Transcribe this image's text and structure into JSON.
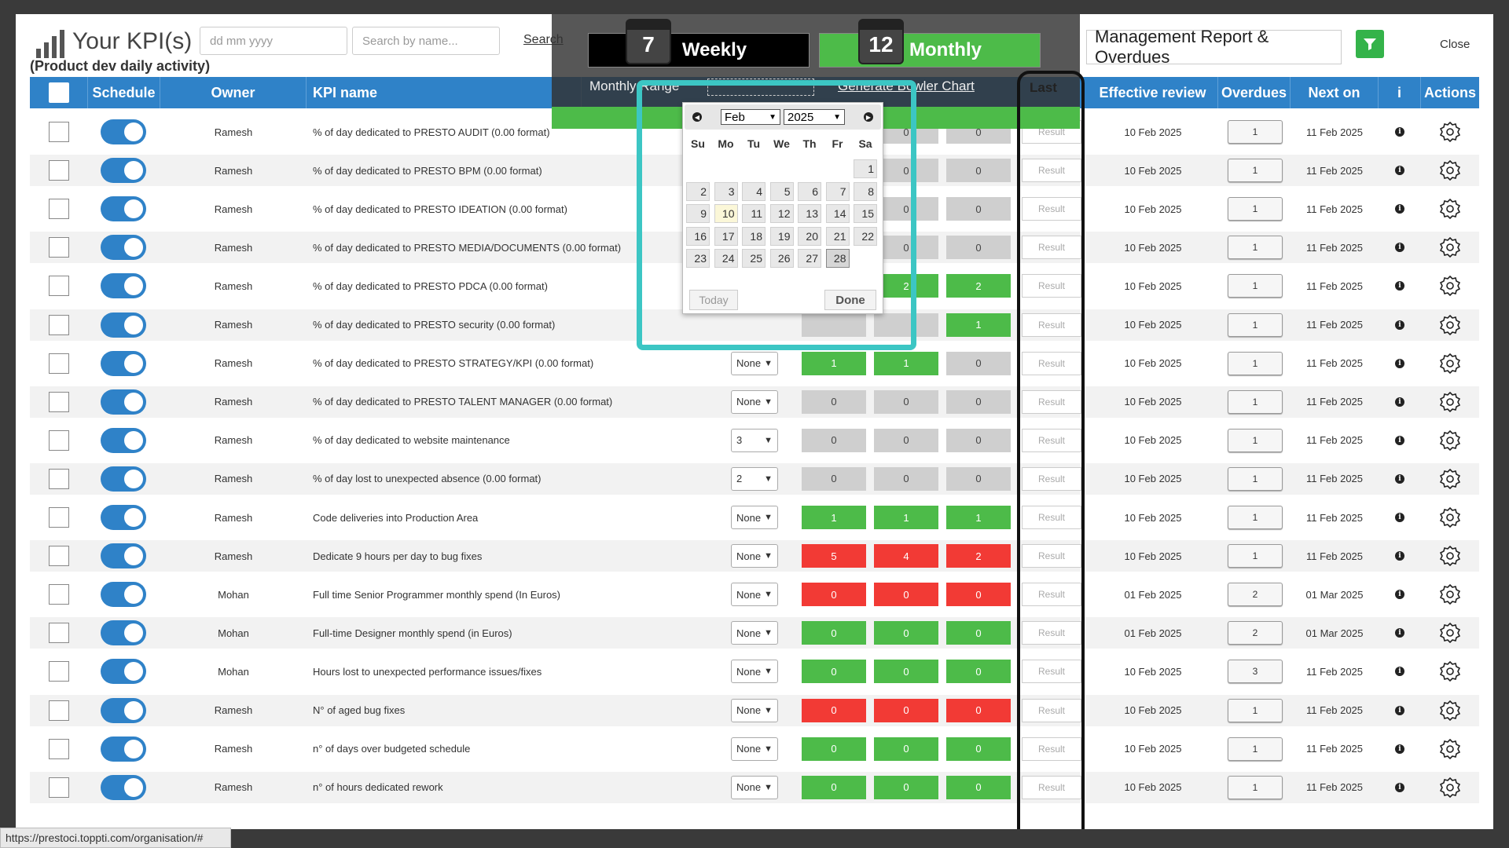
{
  "header": {
    "title": "Your KPI(s)",
    "subtitle": "(Product dev daily activity)",
    "date_placeholder": "dd mm yyyy",
    "search_placeholder": "Search by name...",
    "search_link": "Search",
    "report_title": "Management Report & Overdues",
    "close_label": "Close",
    "filter_icon": "filter-icon"
  },
  "period": {
    "weekly_label": "Weekly",
    "weekly_icon_num": "7",
    "monthly_label": "Monthly",
    "monthly_icon_num": "12",
    "monthly_range_label": "Monthly Range",
    "generate_label": "Generate Bowler Chart",
    "last_label": "Last",
    "accent_color": "#4dbb49"
  },
  "datepicker": {
    "month": "Feb",
    "year": "2025",
    "weekdays": [
      "Su",
      "Mo",
      "Tu",
      "We",
      "Th",
      "Fr",
      "Sa"
    ],
    "weeks": [
      [
        "",
        "",
        "",
        "",
        "",
        "",
        "1"
      ],
      [
        "2",
        "3",
        "4",
        "5",
        "6",
        "7",
        "8"
      ],
      [
        "9",
        "10",
        "11",
        "12",
        "13",
        "14",
        "15"
      ],
      [
        "16",
        "17",
        "18",
        "19",
        "20",
        "21",
        "22"
      ],
      [
        "23",
        "24",
        "25",
        "26",
        "27",
        "28",
        ""
      ]
    ],
    "today": "10",
    "selected": "28",
    "today_btn": "Today",
    "done_btn": "Done"
  },
  "table": {
    "columns": [
      "Schedule",
      "Owner",
      "KPI name",
      "Effective review",
      "Overdues",
      "Next on",
      "i",
      "Actions"
    ],
    "result_placeholder": "Result",
    "rows": [
      {
        "owner": "Ramesh",
        "kpi": "% of day dedicated to PRESTO AUDIT (0.00 format)",
        "select": "",
        "v": [
          "",
          "0",
          "0"
        ],
        "c": [
          "",
          "grey",
          "grey"
        ],
        "review": "10 Feb 2025",
        "overdue": "1",
        "next": "11 Feb 2025"
      },
      {
        "owner": "Ramesh",
        "kpi": "% of day dedicated to PRESTO BPM (0.00 format)",
        "select": "",
        "v": [
          "",
          "0",
          "0"
        ],
        "c": [
          "",
          "grey",
          "grey"
        ],
        "review": "10 Feb 2025",
        "overdue": "1",
        "next": "11 Feb 2025"
      },
      {
        "owner": "Ramesh",
        "kpi": "% of day dedicated to PRESTO IDEATION (0.00 format)",
        "select": "",
        "v": [
          "",
          "0",
          "0"
        ],
        "c": [
          "",
          "grey",
          "grey"
        ],
        "review": "10 Feb 2025",
        "overdue": "1",
        "next": "11 Feb 2025"
      },
      {
        "owner": "Ramesh",
        "kpi": "% of day dedicated to PRESTO MEDIA/DOCUMENTS (0.00 format)",
        "select": "",
        "v": [
          "",
          "0",
          "0"
        ],
        "c": [
          "",
          "grey",
          "grey"
        ],
        "review": "10 Feb 2025",
        "overdue": "1",
        "next": "11 Feb 2025"
      },
      {
        "owner": "Ramesh",
        "kpi": "% of day dedicated to PRESTO PDCA (0.00 format)",
        "select": "",
        "v": [
          "",
          "2",
          "2"
        ],
        "c": [
          "",
          "green",
          "green"
        ],
        "review": "10 Feb 2025",
        "overdue": "1",
        "next": "11 Feb 2025"
      },
      {
        "owner": "Ramesh",
        "kpi": "% of day dedicated to PRESTO security (0.00 format)",
        "select": "",
        "v": [
          "",
          "",
          "1"
        ],
        "c": [
          "grey",
          "grey",
          "green"
        ],
        "review": "10 Feb 2025",
        "overdue": "1",
        "next": "11 Feb 2025"
      },
      {
        "owner": "Ramesh",
        "kpi": "% of day dedicated to PRESTO STRATEGY/KPI (0.00 format)",
        "select": "None",
        "v": [
          "1",
          "1",
          "0"
        ],
        "c": [
          "green",
          "green",
          "grey"
        ],
        "review": "10 Feb 2025",
        "overdue": "1",
        "next": "11 Feb 2025"
      },
      {
        "owner": "Ramesh",
        "kpi": "% of day dedicated to PRESTO TALENT MANAGER (0.00 format)",
        "select": "None",
        "v": [
          "0",
          "0",
          "0"
        ],
        "c": [
          "grey",
          "grey",
          "grey"
        ],
        "review": "10 Feb 2025",
        "overdue": "1",
        "next": "11 Feb 2025"
      },
      {
        "owner": "Ramesh",
        "kpi": "% of day dedicated to website maintenance",
        "select": "3",
        "v": [
          "0",
          "0",
          "0"
        ],
        "c": [
          "grey",
          "grey",
          "grey"
        ],
        "review": "10 Feb 2025",
        "overdue": "1",
        "next": "11 Feb 2025"
      },
      {
        "owner": "Ramesh",
        "kpi": "% of day lost to unexpected absence (0.00 format)",
        "select": "2",
        "v": [
          "0",
          "0",
          "0"
        ],
        "c": [
          "grey",
          "grey",
          "grey"
        ],
        "review": "10 Feb 2025",
        "overdue": "1",
        "next": "11 Feb 2025"
      },
      {
        "owner": "Ramesh",
        "kpi": "Code deliveries into Production Area",
        "select": "None",
        "v": [
          "1",
          "1",
          "1"
        ],
        "c": [
          "green",
          "green",
          "green"
        ],
        "review": "10 Feb 2025",
        "overdue": "1",
        "next": "11 Feb 2025"
      },
      {
        "owner": "Ramesh",
        "kpi": "Dedicate 9 hours per day to bug fixes",
        "select": "None",
        "v": [
          "5",
          "4",
          "2"
        ],
        "c": [
          "red",
          "red",
          "red"
        ],
        "review": "10 Feb 2025",
        "overdue": "1",
        "next": "11 Feb 2025"
      },
      {
        "owner": "Mohan",
        "kpi": "Full time Senior Programmer monthly spend (In Euros)",
        "select": "None",
        "v": [
          "0",
          "0",
          "0"
        ],
        "c": [
          "red",
          "red",
          "red"
        ],
        "review": "01 Feb 2025",
        "overdue": "2",
        "next": "01 Mar 2025"
      },
      {
        "owner": "Mohan",
        "kpi": "Full-time Designer monthly spend (in Euros)",
        "select": "None",
        "v": [
          "0",
          "0",
          "0"
        ],
        "c": [
          "green",
          "green",
          "green"
        ],
        "review": "01 Feb 2025",
        "overdue": "2",
        "next": "01 Mar 2025"
      },
      {
        "owner": "Mohan",
        "kpi": "Hours lost to unexpected performance issues/fixes",
        "select": "None",
        "v": [
          "0",
          "0",
          "0"
        ],
        "c": [
          "green",
          "green",
          "green"
        ],
        "review": "10 Feb 2025",
        "overdue": "3",
        "next": "11 Feb 2025"
      },
      {
        "owner": "Ramesh",
        "kpi": "N° of aged bug fixes",
        "select": "None",
        "v": [
          "0",
          "0",
          "0"
        ],
        "c": [
          "red",
          "red",
          "red"
        ],
        "review": "10 Feb 2025",
        "overdue": "1",
        "next": "11 Feb 2025"
      },
      {
        "owner": "Ramesh",
        "kpi": "n° of days over budgeted schedule",
        "select": "None",
        "v": [
          "0",
          "0",
          "0"
        ],
        "c": [
          "green",
          "green",
          "green"
        ],
        "review": "10 Feb 2025",
        "overdue": "1",
        "next": "11 Feb 2025"
      },
      {
        "owner": "Ramesh",
        "kpi": "n° of hours dedicated rework",
        "select": "None",
        "v": [
          "0",
          "0",
          "0"
        ],
        "c": [
          "green",
          "green",
          "green"
        ],
        "review": "10 Feb 2025",
        "overdue": "1",
        "next": "11 Feb 2025"
      }
    ]
  },
  "status_url": "https://prestoci.toppti.com/organisation/#"
}
